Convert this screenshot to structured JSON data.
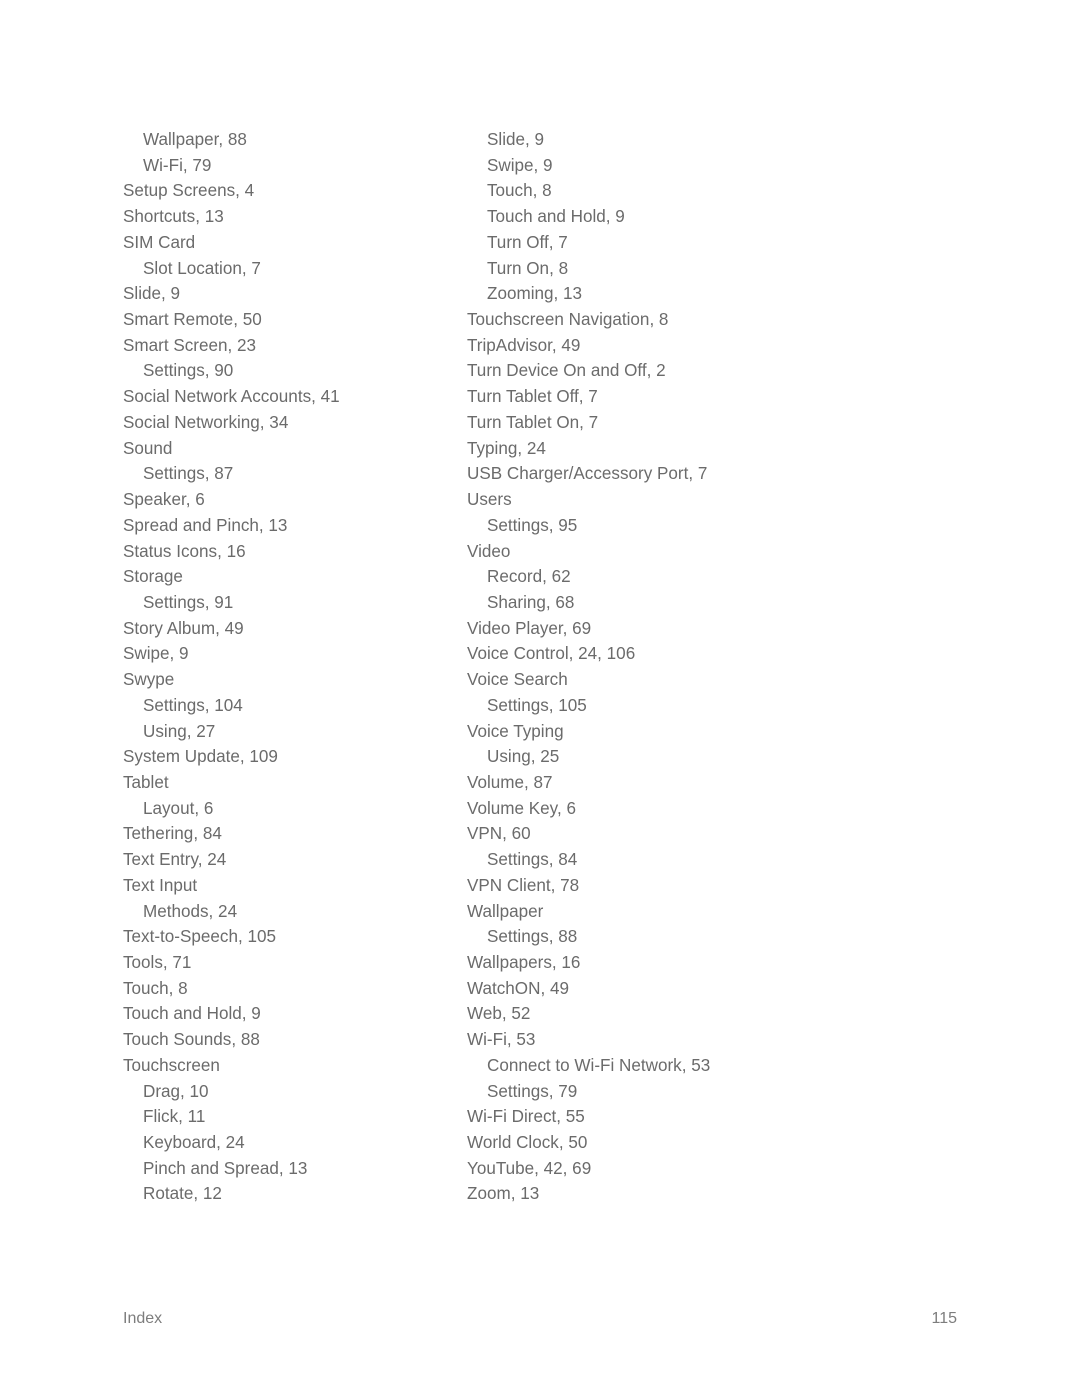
{
  "document": {
    "footer": {
      "section_label": "Index",
      "page_number": "115"
    },
    "text_color": "#6b6b6b",
    "background_color": "#ffffff"
  },
  "index": {
    "left_column": [
      {
        "text": "Wallpaper, 88",
        "level": 2
      },
      {
        "text": "Wi-Fi, 79",
        "level": 2
      },
      {
        "text": "Setup Screens, 4",
        "level": 1
      },
      {
        "text": "Shortcuts, 13",
        "level": 1
      },
      {
        "text": "SIM Card",
        "level": 1
      },
      {
        "text": "Slot Location, 7",
        "level": 2
      },
      {
        "text": "Slide, 9",
        "level": 1
      },
      {
        "text": "Smart Remote, 50",
        "level": 1
      },
      {
        "text": "Smart Screen, 23",
        "level": 1
      },
      {
        "text": "Settings, 90",
        "level": 2
      },
      {
        "text": "Social Network Accounts, 41",
        "level": 1
      },
      {
        "text": "Social Networking, 34",
        "level": 1
      },
      {
        "text": "Sound",
        "level": 1
      },
      {
        "text": "Settings, 87",
        "level": 2
      },
      {
        "text": "Speaker, 6",
        "level": 1
      },
      {
        "text": "Spread and Pinch, 13",
        "level": 1
      },
      {
        "text": "Status Icons, 16",
        "level": 1
      },
      {
        "text": "Storage",
        "level": 1
      },
      {
        "text": "Settings, 91",
        "level": 2
      },
      {
        "text": "Story Album, 49",
        "level": 1
      },
      {
        "text": "Swipe, 9",
        "level": 1
      },
      {
        "text": "Swype",
        "level": 1
      },
      {
        "text": "Settings, 104",
        "level": 2
      },
      {
        "text": "Using, 27",
        "level": 2
      },
      {
        "text": "System Update, 109",
        "level": 1
      },
      {
        "text": "Tablet",
        "level": 1
      },
      {
        "text": "Layout, 6",
        "level": 2
      },
      {
        "text": "Tethering, 84",
        "level": 1
      },
      {
        "text": "Text Entry, 24",
        "level": 1
      },
      {
        "text": "Text Input",
        "level": 1
      },
      {
        "text": "Methods, 24",
        "level": 2
      },
      {
        "text": "Text-to-Speech, 105",
        "level": 1
      },
      {
        "text": "Tools, 71",
        "level": 1
      },
      {
        "text": "Touch, 8",
        "level": 1
      },
      {
        "text": "Touch and Hold, 9",
        "level": 1
      },
      {
        "text": "Touch Sounds, 88",
        "level": 1
      },
      {
        "text": "Touchscreen",
        "level": 1
      },
      {
        "text": "Drag, 10",
        "level": 2
      },
      {
        "text": "Flick, 11",
        "level": 2
      },
      {
        "text": "Keyboard, 24",
        "level": 2
      },
      {
        "text": "Pinch and Spread, 13",
        "level": 2
      },
      {
        "text": "Rotate, 12",
        "level": 2
      }
    ],
    "right_column": [
      {
        "text": "Slide, 9",
        "level": 2
      },
      {
        "text": "Swipe, 9",
        "level": 2
      },
      {
        "text": "Touch, 8",
        "level": 2
      },
      {
        "text": "Touch and Hold, 9",
        "level": 2
      },
      {
        "text": "Turn Off, 7",
        "level": 2
      },
      {
        "text": "Turn On, 8",
        "level": 2
      },
      {
        "text": "Zooming, 13",
        "level": 2
      },
      {
        "text": "Touchscreen Navigation, 8",
        "level": 1
      },
      {
        "text": "TripAdvisor, 49",
        "level": 1
      },
      {
        "text": "Turn Device On and Off, 2",
        "level": 1
      },
      {
        "text": "Turn Tablet Off, 7",
        "level": 1
      },
      {
        "text": "Turn Tablet On, 7",
        "level": 1
      },
      {
        "text": "Typing, 24",
        "level": 1
      },
      {
        "text": "USB Charger/Accessory Port, 7",
        "level": 1
      },
      {
        "text": "Users",
        "level": 1
      },
      {
        "text": "Settings, 95",
        "level": 2
      },
      {
        "text": "Video",
        "level": 1
      },
      {
        "text": "Record, 62",
        "level": 2
      },
      {
        "text": "Sharing, 68",
        "level": 2
      },
      {
        "text": "Video Player, 69",
        "level": 1
      },
      {
        "text": "Voice Control, 24, 106",
        "level": 1
      },
      {
        "text": "Voice Search",
        "level": 1
      },
      {
        "text": "Settings, 105",
        "level": 2
      },
      {
        "text": "Voice Typing",
        "level": 1
      },
      {
        "text": "Using, 25",
        "level": 2
      },
      {
        "text": "Volume, 87",
        "level": 1
      },
      {
        "text": "Volume Key, 6",
        "level": 1
      },
      {
        "text": "VPN, 60",
        "level": 1
      },
      {
        "text": "Settings, 84",
        "level": 2
      },
      {
        "text": "VPN Client, 78",
        "level": 1
      },
      {
        "text": "Wallpaper",
        "level": 1
      },
      {
        "text": "Settings, 88",
        "level": 2
      },
      {
        "text": "Wallpapers, 16",
        "level": 1
      },
      {
        "text": "WatchON, 49",
        "level": 1
      },
      {
        "text": "Web, 52",
        "level": 1
      },
      {
        "text": "Wi-Fi, 53",
        "level": 1
      },
      {
        "text": "Connect to Wi-Fi Network, 53",
        "level": 2
      },
      {
        "text": "Settings, 79",
        "level": 2
      },
      {
        "text": "Wi-Fi Direct, 55",
        "level": 1
      },
      {
        "text": "World Clock, 50",
        "level": 1
      },
      {
        "text": "YouTube, 42, 69",
        "level": 1
      },
      {
        "text": "Zoom, 13",
        "level": 1
      }
    ]
  }
}
